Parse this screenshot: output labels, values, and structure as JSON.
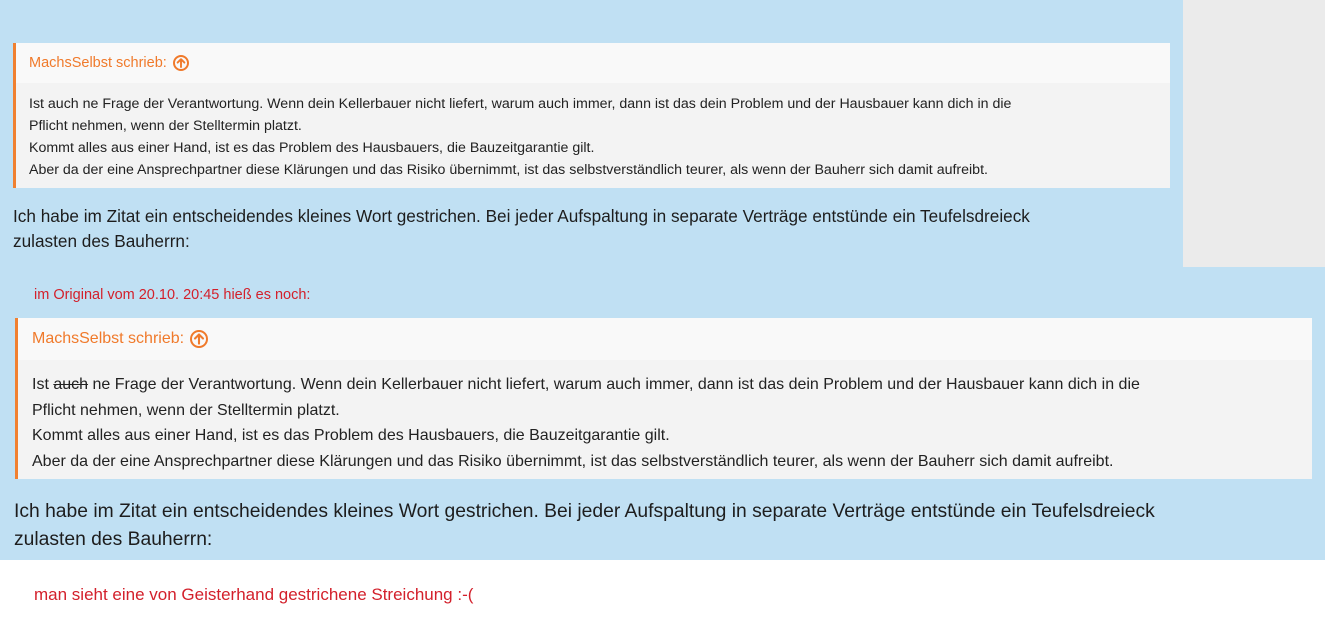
{
  "colors": {
    "page_blue": "#c0e0f3",
    "side_panel": "#ebebeb",
    "quote_bg": "#f3f3f3",
    "quote_accent": "#f08030",
    "note_red": "#d3202b"
  },
  "quote_first": {
    "author": "MachsSelbst schrieb:",
    "icon": "arrow-up-circle-icon",
    "lines": [
      "Ist auch ne Frage der Verantwortung. Wenn dein Kellerbauer nicht liefert, warum auch immer, dann ist das dein Problem und der Hausbauer kann dich in die",
      "Pflicht nehmen, wenn der Stelltermin platzt.",
      "Kommt alles aus einer Hand, ist es das Problem des Hausbauers, die Bauzeitgarantie gilt.",
      "Aber da der eine Ansprechpartner diese Klärungen und das Risiko übernimmt, ist das selbstverständlich teurer, als wenn der Bauherr sich damit aufreibt."
    ]
  },
  "reply_first": {
    "line1": "Ich habe im Zitat ein entscheidendes kleines Wort gestrichen. Bei jeder Aufspaltung in separate Verträge entstünde ein Teufelsdreieck",
    "line2": "zulasten des Bauherrn:"
  },
  "note_original": "im Original vom 20.10. 20:45 hieß es noch:",
  "quote_second": {
    "author": "MachsSelbst schrieb:",
    "icon": "arrow-up-circle-icon",
    "line1_pre": "Ist ",
    "line1_struck": "auch",
    "line1_post": " ne Frage der Verantwortung. Wenn dein Kellerbauer nicht liefert, warum auch immer, dann ist das dein Problem und der Hausbauer kann dich in die",
    "lines_rest": [
      "Pflicht nehmen, wenn der Stelltermin platzt.",
      "Kommt alles aus einer Hand, ist es das Problem des Hausbauers, die Bauzeitgarantie gilt.",
      "Aber da der eine Ansprechpartner diese Klärungen und das Risiko übernimmt, ist das selbstverständlich teurer, als wenn der Bauherr sich damit aufreibt."
    ]
  },
  "reply_second": {
    "line1": "Ich habe im Zitat ein entscheidendes kleines Wort gestrichen. Bei jeder Aufspaltung in separate Verträge entstünde ein Teufelsdreieck",
    "line2": "zulasten des Bauherrn:"
  },
  "note_bottom": "man sieht eine von Geisterhand gestrichene Streichung :-("
}
